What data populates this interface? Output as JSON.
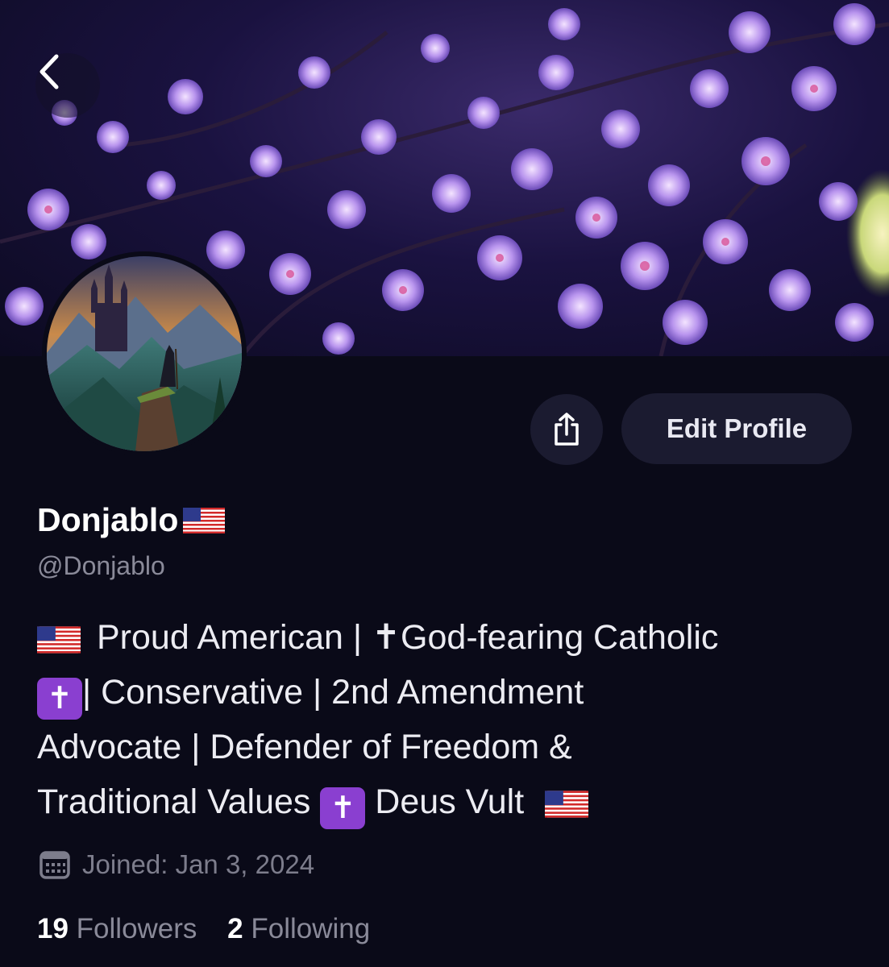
{
  "profile": {
    "display_name": "Donjablo",
    "display_flag": "US flag emoji",
    "handle": "@Donjablo",
    "bio": {
      "line1_text1": "Proud American ",
      "line1_sep": "|",
      "line1_text2": " ✝God-fearing Catholic",
      "line2_text1": "| Conservative | 2nd Amendment",
      "line3_text": "Advocate | Defender of Freedom &",
      "line4_text1": "Traditional Values ",
      "line4_text2": " Deus Vult "
    },
    "joined": "Joined: Jan 3, 2024",
    "followers_count": "19",
    "followers_label": "Followers",
    "following_count": "2",
    "following_label": "Following"
  },
  "actions": {
    "edit_profile_label": "Edit Profile"
  },
  "icons": {
    "back": "chevron-left-icon",
    "share": "share-icon",
    "calendar": "calendar-icon",
    "cross": "latin-cross-emoji",
    "flag": "us-flag-emoji"
  },
  "colors": {
    "background": "#0a0a18",
    "button_bg": "#1b1b30",
    "muted_text": "#8a8a99",
    "cross_emoji_bg": "#8a3fd0"
  }
}
